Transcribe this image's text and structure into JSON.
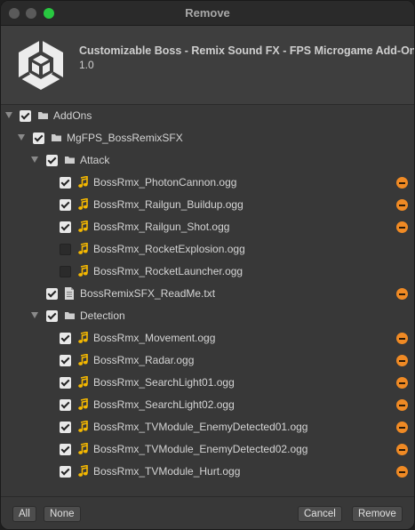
{
  "window": {
    "title": "Remove"
  },
  "package": {
    "name": "Customizable Boss - Remix Sound FX - FPS Microgame Add-On",
    "version": "1.0"
  },
  "tree": {
    "addons": "AddOns",
    "mgfps": "MgFPS_BossRemixSFX",
    "attack": "Attack",
    "photon_cannon": "BossRmx_PhotonCannon.ogg",
    "railgun_buildup": "BossRmx_Railgun_Buildup.ogg",
    "railgun_shot": "BossRmx_Railgun_Shot.ogg",
    "rocket_explosion": "BossRmx_RocketExplosion.ogg",
    "rocket_launcher": "BossRmx_RocketLauncher.ogg",
    "readme": "BossRemixSFX_ReadMe.txt",
    "detection": "Detection",
    "movement": "BossRmx_Movement.ogg",
    "radar": "BossRmx_Radar.ogg",
    "searchlight01": "BossRmx_SearchLight01.ogg",
    "searchlight02": "BossRmx_SearchLight02.ogg",
    "tv_enemy01": "BossRmx_TVModule_EnemyDetected01.ogg",
    "tv_enemy02": "BossRmx_TVModule_EnemyDetected02.ogg",
    "tv_hurt": "BossRmx_TVModule_Hurt.ogg"
  },
  "buttons": {
    "all": "All",
    "none": "None",
    "cancel": "Cancel",
    "remove": "Remove"
  },
  "colors": {
    "accent_remove": "#f08a24",
    "audio_icon": "#f5b800",
    "window_bg": "#383838"
  }
}
